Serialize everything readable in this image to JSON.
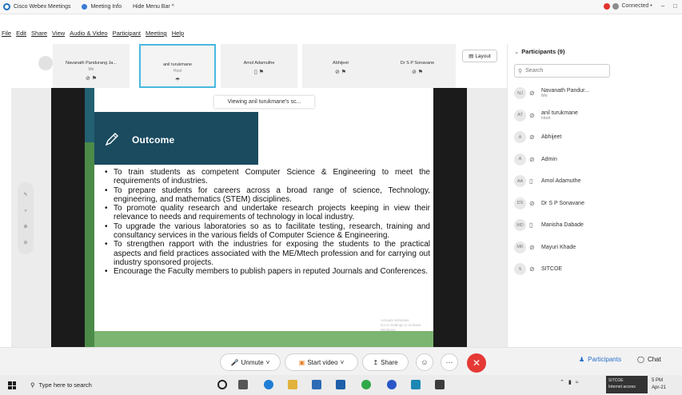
{
  "titlebar": {
    "app": "Cisco Webex Meetings",
    "meeting_info": "Meeting Info",
    "hide_menu": "Hide Menu Bar ^",
    "connected": "Connected •",
    "min": "–",
    "max": "□"
  },
  "menu": [
    "File",
    "Edit",
    "Share",
    "View",
    "Audio & Video",
    "Participant",
    "Meeting",
    "Help"
  ],
  "tiles": [
    {
      "name": "Navanath Pandurang Ja...",
      "sub": "Me",
      "icons": "⊘ ⚑"
    },
    {
      "name": "anil turukmane",
      "sub": "Host",
      "icons": "☂"
    },
    {
      "name": "Amol Adamuthe",
      "sub": "",
      "icons": "▯ ⚑"
    },
    {
      "name": "Abhijeet",
      "sub": "",
      "icons": "⊘ ⚑"
    },
    {
      "name": "Dr S P Sonavane",
      "sub": "",
      "icons": "⊘ ⚑"
    }
  ],
  "layout_label": "Layout",
  "viewing": "Viewing anil turukmane's sc...",
  "slide": {
    "heading": "Outcome",
    "bullets": [
      "To train students as competent Computer Science & Engineering to meet the requirements of industries.",
      "To prepare students for careers across a broad range of science, Technology, engineering, and mathematics (STEM) disciplines.",
      "To promote quality research and undertake research projects keeping in view their relevance to needs and requirements of technology in local industry.",
      "To upgrade the various laboratories so as to facilitate testing, research, training and consultancy services in the various fields of Computer Science & Engineering.",
      "To strengthen rapport with the industries for exposing the students to the practical aspects and field practices associated with the ME/Mtech profession and for carrying out industry sponsored projects.",
      "Encourage the Faculty members to publish papers in reputed Journals and Conferences."
    ],
    "watermark": "Activate Windows\nGo to Settings to activate Windows."
  },
  "participants": {
    "header": "Participants (9)",
    "search_placeholder": "Search",
    "list": [
      {
        "initials": "NJ",
        "name": "Navanath Pandur...",
        "sub": "Me",
        "icon": "⊘"
      },
      {
        "initials": "AT",
        "name": "anil turukmane",
        "sub": "Host",
        "icon": "⊘"
      },
      {
        "initials": "A",
        "name": "Abhijeet",
        "sub": "",
        "icon": "⊘"
      },
      {
        "initials": "A",
        "name": "Admin",
        "sub": "",
        "icon": "⊘"
      },
      {
        "initials": "AA",
        "name": "Amol Adamuthe",
        "sub": "",
        "icon": "▯"
      },
      {
        "initials": "DS",
        "name": "Dr S P Sonavane",
        "sub": "",
        "icon": "⊘"
      },
      {
        "initials": "MD",
        "name": "Manisha Dabade",
        "sub": "",
        "icon": "▯"
      },
      {
        "initials": "MK",
        "name": "Mayuri Khade",
        "sub": "",
        "icon": "⊘"
      },
      {
        "initials": "S",
        "name": "SITCOE",
        "sub": "",
        "icon": "⊘"
      }
    ]
  },
  "controls": {
    "unmute": "Unmute",
    "start_video": "Start video",
    "share": "Share",
    "participants": "Participants",
    "chat": "Chat"
  },
  "taskbar": {
    "search": "Type here to search",
    "net_title": "SITCOE",
    "net_sub": "Internet access",
    "time": "5 PM",
    "date": "Apr-21"
  }
}
